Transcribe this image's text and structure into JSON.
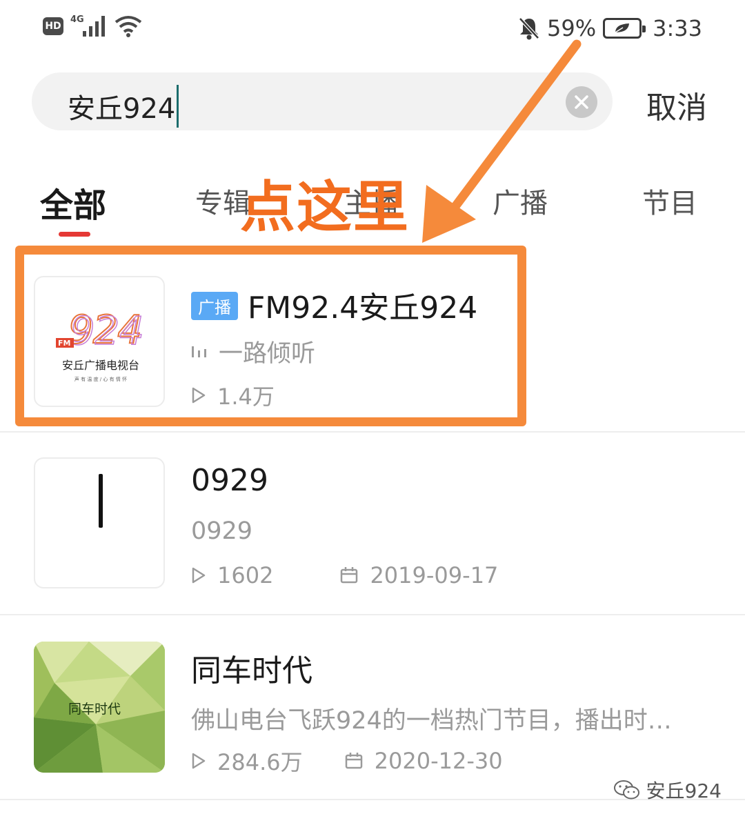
{
  "status_bar": {
    "hd": "HD",
    "network": "4G",
    "battery_percent": "59%",
    "time": "3:33"
  },
  "search": {
    "query": "安丘924",
    "cancel_label": "取消"
  },
  "tabs": [
    {
      "label": "全部",
      "active": true
    },
    {
      "label": "专辑",
      "active": false
    },
    {
      "label": "主播",
      "active": false
    },
    {
      "label": "广播",
      "active": false
    },
    {
      "label": "节目",
      "active": false
    }
  ],
  "annotation": {
    "text": "点这里",
    "color": "#f58a3b"
  },
  "results": [
    {
      "tag": "广播",
      "title": "FM92.4安丘924",
      "subtitle": "一路倾听",
      "plays": "1.4万",
      "date": "",
      "thumb_logo_number": "924",
      "thumb_logo_fm": "FM",
      "thumb_logo_name": "安丘广播电视台",
      "thumb_logo_slogan": "声 有 温 度 / 心 有 情 怀"
    },
    {
      "tag": "",
      "title": "0929",
      "subtitle": "0929",
      "plays": "1602",
      "date": "2019-09-17"
    },
    {
      "tag": "",
      "title": "同车时代",
      "subtitle": "佛山电台飞跃924的一档热门节目，播出时…",
      "plays": "284.6万",
      "date": "2020-12-30",
      "thumb_text": "同车时代"
    }
  ],
  "watermark": "安丘924",
  "icons": {
    "bell_muted": "bell-off-icon",
    "wifi": "wifi-icon",
    "signal": "signal-icon",
    "play": "play-icon",
    "calendar": "calendar-icon",
    "bars": "audio-bars-icon",
    "clear": "clear-icon",
    "wechat": "wechat-icon"
  }
}
